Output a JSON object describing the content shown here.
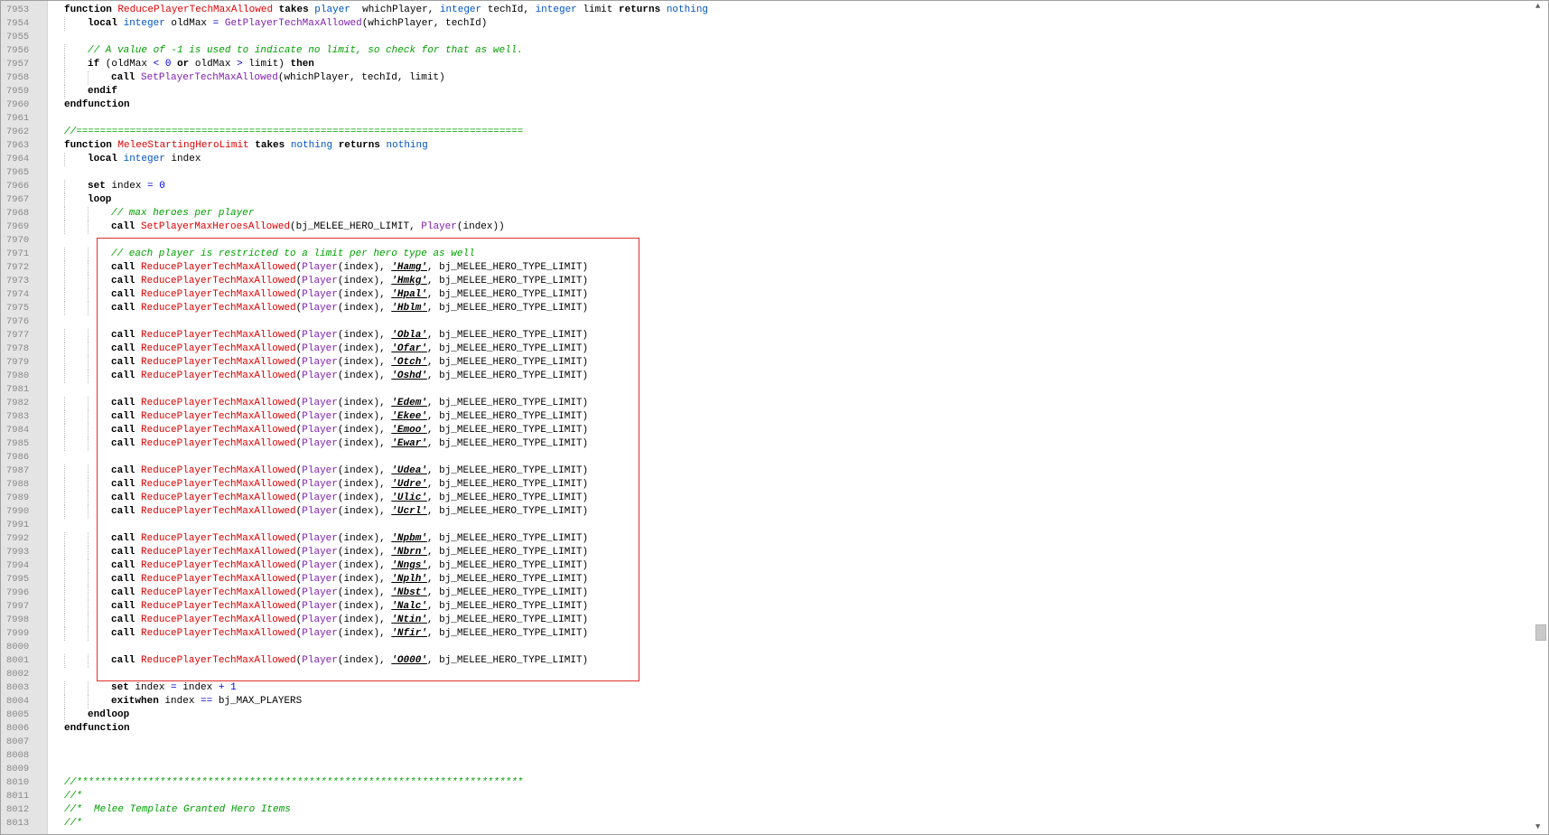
{
  "editor": {
    "lines": [
      {
        "n": "7953",
        "i": 0,
        "t": [
          [
            "kw",
            "function "
          ],
          [
            "fnr",
            "ReducePlayerTechMaxAllowed"
          ],
          [
            "kw",
            " takes "
          ],
          [
            "ty",
            "player"
          ],
          [
            "",
            "  whichPlayer, "
          ],
          [
            "ty",
            "integer"
          ],
          [
            "",
            " techId, "
          ],
          [
            "ty",
            "integer"
          ],
          [
            "",
            " limit "
          ],
          [
            "kw",
            "returns"
          ],
          [
            "",
            " "
          ],
          [
            "ty",
            "nothing"
          ]
        ]
      },
      {
        "n": "7954",
        "i": 1,
        "t": [
          [
            "kw",
            "local "
          ],
          [
            "ty",
            "integer"
          ],
          [
            "",
            " oldMax "
          ],
          [
            "op",
            "="
          ],
          [
            "",
            " "
          ],
          [
            "fnp",
            "GetPlayerTechMaxAllowed"
          ],
          [
            "",
            "(whichPlayer, techId)"
          ]
        ]
      },
      {
        "n": "7955",
        "i": 0,
        "t": []
      },
      {
        "n": "7956",
        "i": 1,
        "t": [
          [
            "cm",
            "// A value of -1 is used to indicate no limit, so check for that as well."
          ]
        ]
      },
      {
        "n": "7957",
        "i": 1,
        "t": [
          [
            "kw",
            "if"
          ],
          [
            "",
            " (oldMax "
          ],
          [
            "op",
            "<"
          ],
          [
            "",
            " "
          ],
          [
            "num",
            "0"
          ],
          [
            "",
            " "
          ],
          [
            "kw",
            "or"
          ],
          [
            "",
            " oldMax "
          ],
          [
            "op",
            ">"
          ],
          [
            "",
            " limit) "
          ],
          [
            "kw",
            "then"
          ]
        ]
      },
      {
        "n": "7958",
        "i": 2,
        "t": [
          [
            "kw",
            "call "
          ],
          [
            "fnp",
            "SetPlayerTechMaxAllowed"
          ],
          [
            "",
            "(whichPlayer, techId, limit)"
          ]
        ]
      },
      {
        "n": "7959",
        "i": 1,
        "t": [
          [
            "kw",
            "endif"
          ]
        ]
      },
      {
        "n": "7960",
        "i": 0,
        "t": [
          [
            "kw",
            "endfunction"
          ]
        ]
      },
      {
        "n": "7961",
        "i": 0,
        "t": []
      },
      {
        "n": "7962",
        "i": 0,
        "t": [
          [
            "cm",
            "//==========================================================================="
          ]
        ]
      },
      {
        "n": "7963",
        "i": 0,
        "t": [
          [
            "kw",
            "function "
          ],
          [
            "fnr",
            "MeleeStartingHeroLimit"
          ],
          [
            "kw",
            " takes "
          ],
          [
            "ty",
            "nothing"
          ],
          [
            "kw",
            " returns "
          ],
          [
            "ty",
            "nothing"
          ]
        ]
      },
      {
        "n": "7964",
        "i": 1,
        "t": [
          [
            "kw",
            "local "
          ],
          [
            "ty",
            "integer"
          ],
          [
            "",
            " index"
          ]
        ]
      },
      {
        "n": "7965",
        "i": 0,
        "t": []
      },
      {
        "n": "7966",
        "i": 1,
        "t": [
          [
            "kw",
            "set"
          ],
          [
            "",
            " index "
          ],
          [
            "op",
            "="
          ],
          [
            "",
            " "
          ],
          [
            "num",
            "0"
          ]
        ]
      },
      {
        "n": "7967",
        "i": 1,
        "t": [
          [
            "kw",
            "loop"
          ]
        ]
      },
      {
        "n": "7968",
        "i": 2,
        "t": [
          [
            "cm",
            "// max heroes per player"
          ]
        ]
      },
      {
        "n": "7969",
        "i": 2,
        "t": [
          [
            "kw",
            "call "
          ],
          [
            "fnr",
            "SetPlayerMaxHeroesAllowed"
          ],
          [
            "",
            "(bj_MELEE_HERO_LIMIT, "
          ],
          [
            "fnp",
            "Player"
          ],
          [
            "",
            "(index))"
          ]
        ]
      },
      {
        "n": "7970",
        "i": 0,
        "t": []
      },
      {
        "n": "7971",
        "i": 2,
        "t": [
          [
            "cm",
            "// each player is restricted to a limit per hero type as well"
          ]
        ]
      },
      {
        "n": "7972",
        "i": 2,
        "r": "'Hamg'"
      },
      {
        "n": "7973",
        "i": 2,
        "r": "'Hmkg'"
      },
      {
        "n": "7974",
        "i": 2,
        "r": "'Hpal'"
      },
      {
        "n": "7975",
        "i": 2,
        "r": "'Hblm'"
      },
      {
        "n": "7976",
        "i": 0,
        "t": []
      },
      {
        "n": "7977",
        "i": 2,
        "r": "'Obla'"
      },
      {
        "n": "7978",
        "i": 2,
        "r": "'Ofar'"
      },
      {
        "n": "7979",
        "i": 2,
        "r": "'Otch'"
      },
      {
        "n": "7980",
        "i": 2,
        "r": "'Oshd'"
      },
      {
        "n": "7981",
        "i": 0,
        "t": []
      },
      {
        "n": "7982",
        "i": 2,
        "r": "'Edem'"
      },
      {
        "n": "7983",
        "i": 2,
        "r": "'Ekee'"
      },
      {
        "n": "7984",
        "i": 2,
        "r": "'Emoo'"
      },
      {
        "n": "7985",
        "i": 2,
        "r": "'Ewar'"
      },
      {
        "n": "7986",
        "i": 0,
        "t": []
      },
      {
        "n": "7987",
        "i": 2,
        "r": "'Udea'"
      },
      {
        "n": "7988",
        "i": 2,
        "r": "'Udre'"
      },
      {
        "n": "7989",
        "i": 2,
        "r": "'Ulic'"
      },
      {
        "n": "7990",
        "i": 2,
        "r": "'Ucrl'"
      },
      {
        "n": "7991",
        "i": 0,
        "t": []
      },
      {
        "n": "7992",
        "i": 2,
        "r": "'Npbm'"
      },
      {
        "n": "7993",
        "i": 2,
        "r": "'Nbrn'"
      },
      {
        "n": "7994",
        "i": 2,
        "r": "'Nngs'"
      },
      {
        "n": "7995",
        "i": 2,
        "r": "'Nplh'"
      },
      {
        "n": "7996",
        "i": 2,
        "r": "'Nbst'"
      },
      {
        "n": "7997",
        "i": 2,
        "r": "'Nalc'"
      },
      {
        "n": "7998",
        "i": 2,
        "r": "'Ntin'"
      },
      {
        "n": "7999",
        "i": 2,
        "r": "'Nfir'"
      },
      {
        "n": "8000",
        "i": 0,
        "t": []
      },
      {
        "n": "8001",
        "i": 2,
        "r": "'O000'"
      },
      {
        "n": "8002",
        "i": 0,
        "t": []
      },
      {
        "n": "8003",
        "i": 2,
        "t": [
          [
            "kw",
            "set"
          ],
          [
            "",
            " index "
          ],
          [
            "op",
            "="
          ],
          [
            "",
            " index "
          ],
          [
            "op",
            "+"
          ],
          [
            "",
            " "
          ],
          [
            "num",
            "1"
          ]
        ]
      },
      {
        "n": "8004",
        "i": 2,
        "t": [
          [
            "kw",
            "exitwhen"
          ],
          [
            "",
            " index "
          ],
          [
            "op",
            "=="
          ],
          [
            "",
            " bj_MAX_PLAYERS"
          ]
        ]
      },
      {
        "n": "8005",
        "i": 1,
        "t": [
          [
            "kw",
            "endloop"
          ]
        ]
      },
      {
        "n": "8006",
        "i": 0,
        "t": [
          [
            "kw",
            "endfunction"
          ]
        ]
      },
      {
        "n": "8007",
        "i": 0,
        "t": []
      },
      {
        "n": "8008",
        "i": 0,
        "t": []
      },
      {
        "n": "8009",
        "i": 0,
        "t": []
      },
      {
        "n": "8010",
        "i": 0,
        "t": [
          [
            "cm",
            "//***************************************************************************"
          ]
        ]
      },
      {
        "n": "8011",
        "i": 0,
        "t": [
          [
            "cm",
            "//*"
          ]
        ]
      },
      {
        "n": "8012",
        "i": 0,
        "t": [
          [
            "cm",
            "//*  Melee Template Granted Hero Items"
          ]
        ]
      },
      {
        "n": "8013",
        "i": 0,
        "t": [
          [
            "cm",
            "//*"
          ]
        ]
      }
    ],
    "reduce_call": {
      "call_kw": "call ",
      "func": "ReducePlayerTechMaxAllowed",
      "player_fn": "Player",
      "index_arg": "(index), ",
      "suffix": ", bj_MELEE_HERO_TYPE_LIMIT)"
    },
    "scrollbar": {
      "up_icon": "▲",
      "down_icon": "▼"
    }
  }
}
